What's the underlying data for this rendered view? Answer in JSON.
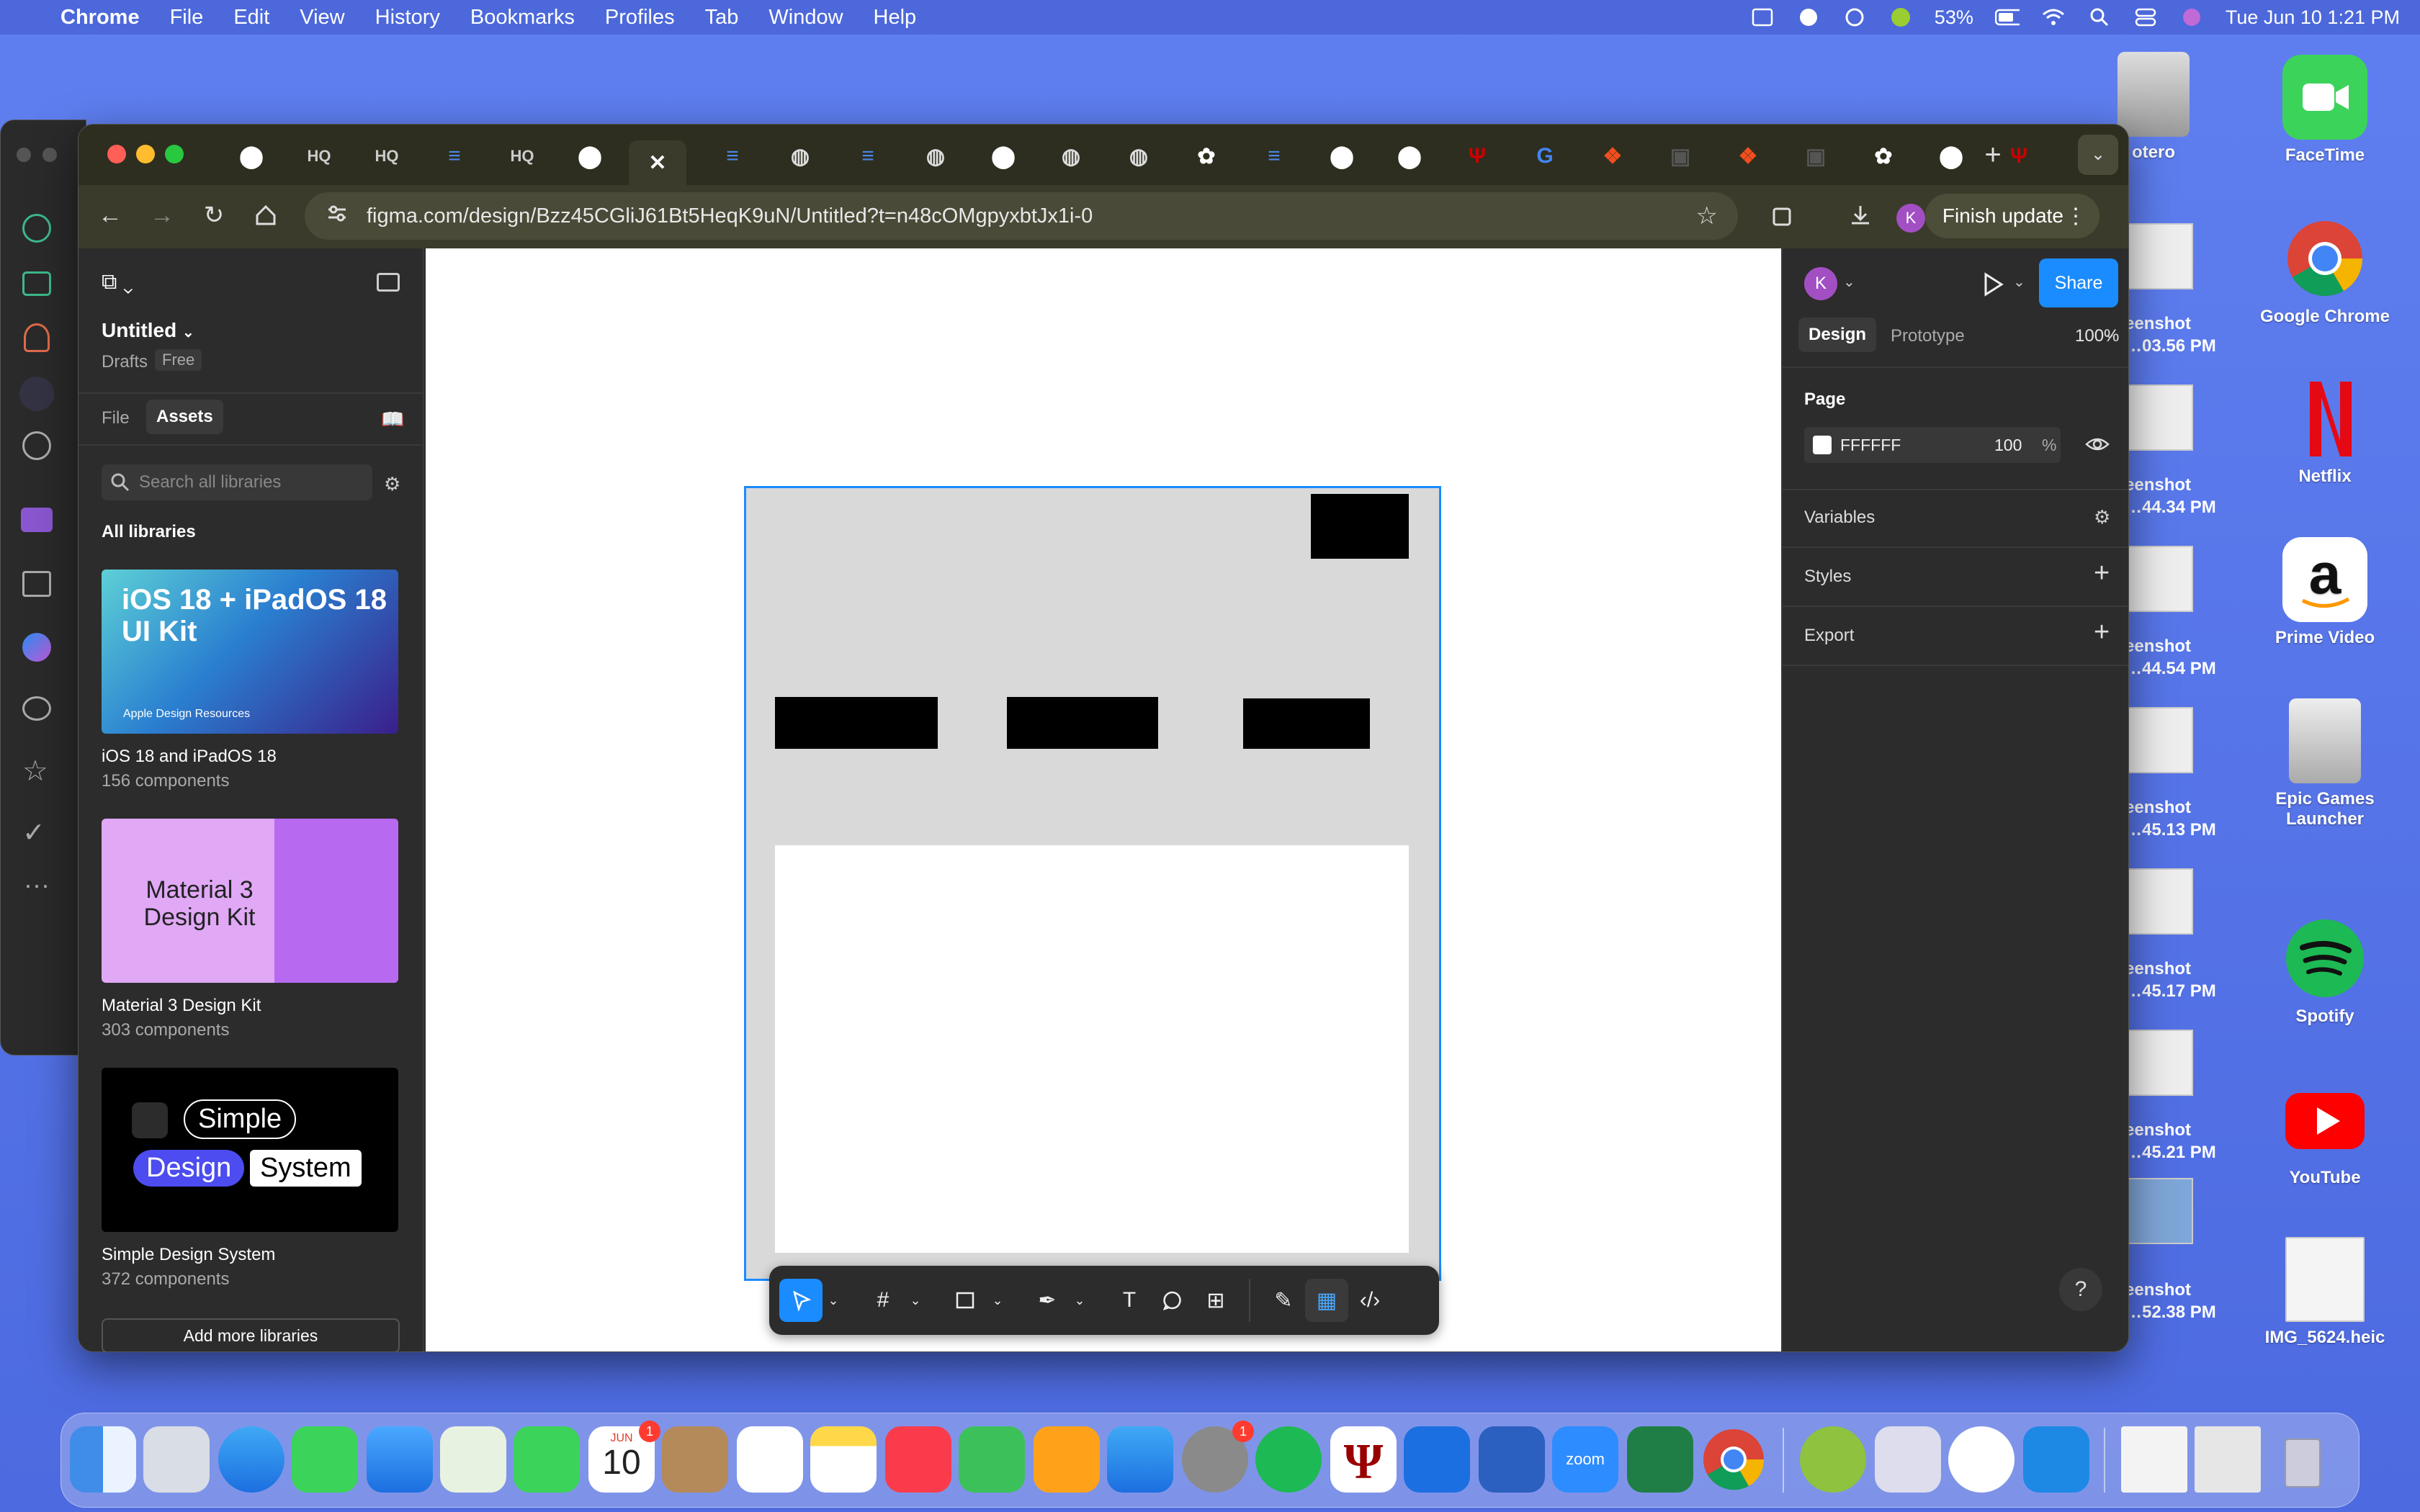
{
  "menubar": {
    "app_name": "Chrome",
    "menus": [
      "File",
      "Edit",
      "View",
      "History",
      "Bookmarks",
      "Profiles",
      "Tab",
      "Window",
      "Help"
    ],
    "battery": "53%",
    "datetime": "Tue Jun 10  1:21 PM"
  },
  "desktop": {
    "items": [
      {
        "label": "Zotero",
        "partial": "otero"
      },
      {
        "label": "FaceTime"
      },
      {
        "label": "Google Chrome"
      },
      {
        "label": "Netflix"
      },
      {
        "label": "Prime Video"
      },
      {
        "label": "Epic Games Launcher"
      },
      {
        "label": "Spotify"
      },
      {
        "label": "YouTube"
      },
      {
        "label": "IMG_5624.heic"
      }
    ],
    "screenshots": [
      {
        "l1": "eenshot",
        "l2": "…03.56 PM"
      },
      {
        "l1": "eenshot",
        "l2": "…44.34 PM"
      },
      {
        "l1": "eenshot",
        "l2": "…44.54 PM"
      },
      {
        "l1": "eenshot",
        "l2": "…45.13 PM"
      },
      {
        "l1": "eenshot",
        "l2": "…45.17 PM"
      },
      {
        "l1": "eenshot",
        "l2": "…45.21 PM"
      },
      {
        "l1": "eenshot",
        "l2": "…52.38 PM"
      }
    ]
  },
  "browser": {
    "url": "figma.com/design/Bzz45CGliJ61Bt5HeqK9uN/Untitled?t=n48cOMgpyxbtJx1i-0",
    "finish_update": "Finish update",
    "profile_initial": "K",
    "tabs": [
      "github",
      "HQ",
      "HQ",
      "docs",
      "HQ",
      "github",
      "close",
      "docs",
      "web",
      "docs",
      "web",
      "github",
      "web",
      "web",
      "openai",
      "docs",
      "github",
      "github",
      "iu",
      "google",
      "figma",
      "img",
      "figma",
      "img",
      "openai",
      "github",
      "iu"
    ]
  },
  "figma_left": {
    "file_name": "Untitled",
    "location": "Drafts",
    "plan_badge": "Free",
    "tabs": {
      "file": "File",
      "assets": "Assets"
    },
    "search_placeholder": "Search all libraries",
    "section_title": "All libraries",
    "libraries": [
      {
        "name": "iOS 18 and iPadOS 18",
        "count": "156 components",
        "thumb_title": "iOS 18 + iPadOS 18 UI Kit",
        "thumb_sub": "Apple Design Resources"
      },
      {
        "name": "Material 3 Design Kit",
        "count": "303 components",
        "thumb_title": "Material 3 Design Kit"
      },
      {
        "name": "Simple Design System",
        "count": "372 components",
        "thumb_words": [
          "Simple",
          "Design",
          "System"
        ]
      }
    ],
    "add_more": "Add more libraries"
  },
  "figma_right": {
    "avatar_initial": "K",
    "share": "Share",
    "tabs": {
      "design": "Design",
      "prototype": "Prototype"
    },
    "zoom": "100%",
    "page_title": "Page",
    "page_color": "FFFFFF",
    "page_opacity": "100",
    "page_opacity_unit": "%",
    "sections": [
      "Variables",
      "Styles",
      "Export"
    ],
    "help": "?"
  },
  "dock": {
    "calendar_month": "JUN",
    "calendar_day": "10",
    "calendar_badge": "1",
    "settings_badge": "1",
    "zoom_label": "zoom"
  }
}
